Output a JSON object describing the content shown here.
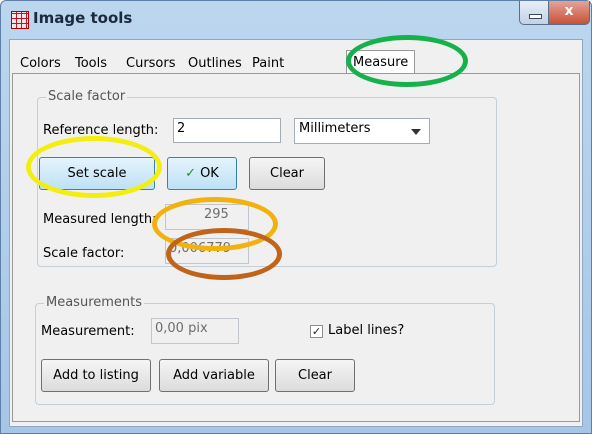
{
  "window": {
    "title": "Image tools",
    "close_glyph": "x"
  },
  "tabs": [
    {
      "label": "Colors"
    },
    {
      "label": "Tools"
    },
    {
      "label": "Cursors"
    },
    {
      "label": "Outlines"
    },
    {
      "label": "Paint"
    },
    {
      "label": "Measure",
      "active": true
    }
  ],
  "scale_factor": {
    "group_title": "Scale factor",
    "reference_label": "Reference length:",
    "reference_value": "2",
    "unit_selected": "Millimeters",
    "set_scale_label": "Set scale",
    "ok_label": "OK",
    "ok_check": "✓",
    "clear_label": "Clear",
    "measured_label": "Measured length:",
    "measured_value": "295",
    "scale_label": "Scale factor:",
    "scale_value": "0,006779"
  },
  "measurements": {
    "group_title": "Measurements",
    "measurement_label": "Measurement:",
    "measurement_value": "0,00 pix",
    "label_lines_label": "Label lines?",
    "label_lines_checked": true,
    "check_glyph": "✓",
    "add_listing_label": "Add to listing",
    "add_variable_label": "Add variable",
    "clear_label": "Clear"
  },
  "annotations": [
    {
      "name": "green-ring",
      "color": "#16b14a"
    },
    {
      "name": "yellow-ring",
      "color": "#f3ee10"
    },
    {
      "name": "orange-ring",
      "color": "#f2b10f"
    },
    {
      "name": "brown-ring",
      "color": "#c0641b"
    }
  ]
}
